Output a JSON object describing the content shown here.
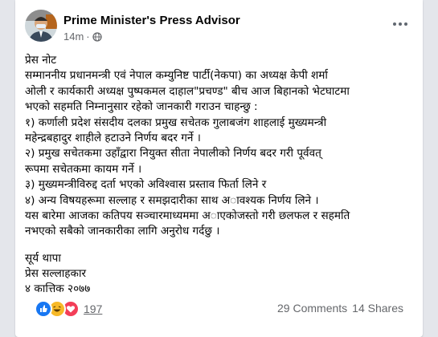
{
  "post": {
    "author": "Prime Minister's Press Advisor",
    "time": "14m",
    "separator": "·",
    "lines": [
      "प्रेस नोट",
      "सम्माननीय प्रधानमन्त्री एवं नेपाल कम्युनिष्ट पार्टी(नेकपा) का अध्यक्ष केपी शर्मा",
      "ओली र कार्यकारी अध्यक्ष पुष्पकमल दाहाल\"प्रचण्ड\" बीच आज बिहानको भेटघाटमा",
      "भएको सहमति निम्नानुसार रहेको जानकारी गराउन चाहन्छु :",
      "१) कर्णाली प्रदेश संसदीय दलका प्रमुख सचेतक गुलाबजंग शाहलाई मुख्यमन्त्री",
      "महेन्द्रबहादुर शाहीले हटाउने निर्णय बदर गर्ने ।",
      "२)  प्रमुख सचेतकमा उहाँद्वारा नियुक्त सीता नेपालीको निर्णय बदर गरी पूर्ववत्",
      "रूपमा सचेतकमा कायम गर्ने ।",
      "३) मुख्यमन्त्रीविरुद्द दर्ता भएको अविश्वास प्रस्ताव फिर्ता लिने र",
      "४) अन्य विषयहरूमा सल्लाह र समझदारीका साथ अावश्यक निर्णय लिने ।",
      "यस बारेमा आजका कतिपय सञ्चारमाध्यममा अाएकोजस्तो गरी छलफल र सहमति",
      "नभएको सबैको जानकारीका लागि अनुरोध गर्दछु ।"
    ],
    "signature": [
      "सूर्य थापा",
      "प्रेस सल्लाहकार",
      "४ कात्तिक २०७७"
    ]
  },
  "footer": {
    "reaction_count": "197",
    "comments": "29 Comments",
    "shares": "14 Shares"
  },
  "icons": {
    "audience": "globe-icon",
    "reactions": [
      "like-icon",
      "haha-icon",
      "love-icon"
    ],
    "menu": "more-options-icon"
  },
  "colors": {
    "like": "#1877f2",
    "haha": "#f7b928",
    "love": "#f33e58",
    "secondary_text": "#65676b"
  }
}
